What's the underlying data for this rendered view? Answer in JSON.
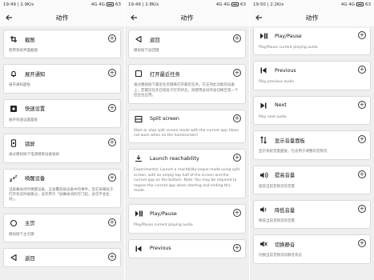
{
  "screens": [
    {
      "status": {
        "time": "19:49 | 2.9K/s",
        "net": "4G 4G",
        "battery": "63"
      },
      "title": "动作",
      "cards": [
        {
          "icon": "crop-icon",
          "name": "截图",
          "desc": "使用系统界面截图"
        },
        {
          "icon": "bell-icon",
          "name": "展开通知",
          "desc": "展开通知面板"
        },
        {
          "icon": "quick-settings-icon",
          "name": "快速设置",
          "desc": "展开快速设置面板"
        },
        {
          "icon": "lock-screen-icon",
          "name": "锁屏",
          "desc": "通过模拟按下电源键来设备锁屏"
        },
        {
          "icon": "sleep-icon",
          "name": "唤醒设备",
          "desc": "当屏幕关闭时唤醒设备，这会覆盖按设备中的事件。且在屏幕处于打开状态时被路过，该作用于「屏幕关闭的打门起，此仅不会生效」。"
        },
        {
          "icon": "home-icon",
          "name": "主页",
          "desc": "模拟按下主页键"
        },
        {
          "icon": "back-icon",
          "name": "返回",
          "desc": ""
        }
      ]
    },
    {
      "status": {
        "time": "19:49 | 2.8K/s",
        "net": "4G 4G",
        "battery": "63"
      },
      "title": "动作",
      "cards": [
        {
          "icon": "back-icon",
          "name": "返回",
          "desc": "模拟按下返回键"
        },
        {
          "icon": "recents-icon",
          "name": "打开最近任务",
          "desc": "通过模拟按下最近任务键来打开最近任务。在支持此功能的设备上，若最近任务已经处于打开状态，则使用此动作会切换至第一个后台台应用。"
        },
        {
          "icon": "split-screen-icon",
          "name": "Split screen",
          "desc": "Start or stop split screen mode with the current app (does not work when on the homescreen)"
        },
        {
          "icon": "reachability-icon",
          "name": "Launch reachability",
          "desc": "Experimental: Launch a reachbility-esque mode using split screen, with an empty top half of the screen and the current app on the bottom. Note: You may be required to reopen the current app when starting and ending this mode."
        },
        {
          "icon": "play-pause-icon",
          "name": "Play/Pause",
          "desc": "Play/Pause current playing audio"
        },
        {
          "icon": "previous-icon",
          "name": "Previous",
          "desc": ""
        }
      ]
    },
    {
      "status": {
        "time": "19:50 | 2.2K/s",
        "net": "4G 4G",
        "battery": "63"
      },
      "title": "动作",
      "cards": [
        {
          "icon": "play-pause-icon",
          "name": "Play/Pause",
          "desc": "Play/Pause current playing audio"
        },
        {
          "icon": "previous-icon",
          "name": "Previous",
          "desc": "Play previous audio"
        },
        {
          "icon": "next-icon",
          "name": "Next",
          "desc": "Play next audio"
        },
        {
          "icon": "volume-panel-icon",
          "name": "显示音量面板",
          "desc": "显示系统音量面板，包含用于调整的音频流"
        },
        {
          "icon": "volume-up-icon",
          "name": "提高音量",
          "desc": "提高当前音频流的音量"
        },
        {
          "icon": "volume-down-icon",
          "name": "降低音量",
          "desc": "降低当前音频流的音量"
        },
        {
          "icon": "mute-icon",
          "name": "切换静音",
          "desc": "切换当前音频流的静音状态"
        }
      ]
    }
  ],
  "add_glyph": "+"
}
